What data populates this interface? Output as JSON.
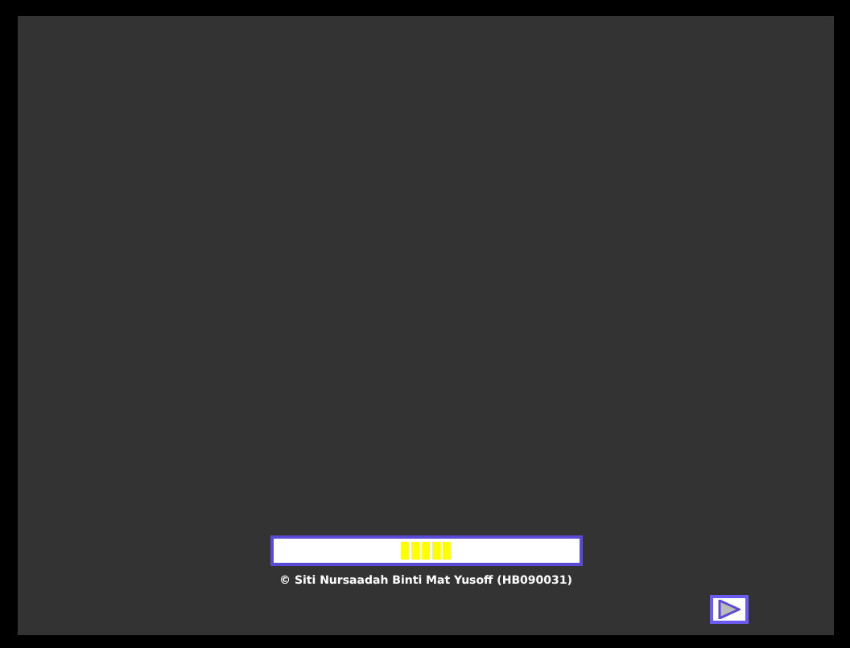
{
  "loader": {
    "credit": "© Siti Nursaadah Binti Mat Yusoff (HB090031)"
  }
}
